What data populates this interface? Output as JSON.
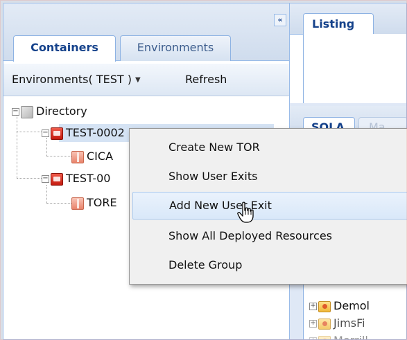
{
  "left_panel": {
    "collapse_icon": "double-chevron-left-icon",
    "tabs": [
      {
        "label": "Containers",
        "active": true
      },
      {
        "label": "Environments",
        "active": false
      }
    ],
    "toolbar": {
      "env_menu_label": "Environments( TEST )",
      "env_menu_caret": "▼",
      "refresh_label": "Refresh"
    },
    "tree": {
      "root": {
        "label": "Directory",
        "icon": "directory-icon",
        "expanded": true
      },
      "items": [
        {
          "label": "TEST-0002",
          "icon": "server-group-icon",
          "expanded": true,
          "selected": true
        },
        {
          "label": "CICA",
          "icon": "package-icon"
        },
        {
          "label": "TEST-00",
          "icon": "server-group-icon",
          "expanded": true
        },
        {
          "label": "TORE",
          "icon": "package-icon"
        }
      ]
    }
  },
  "right_panel": {
    "top_tab": "Listing",
    "inner_tabs": [
      {
        "label": "SOLA",
        "active": true
      },
      {
        "label": "Ma",
        "active": false
      }
    ],
    "tree_items": [
      {
        "label": "Demol",
        "icon": "folder-icon"
      },
      {
        "label": "JimsFi",
        "icon": "folder-icon"
      },
      {
        "label": "Merrill",
        "icon": "folder-icon"
      }
    ]
  },
  "context_menu": {
    "items": [
      {
        "label": "Create New TOR"
      },
      {
        "label": "Show User Exits"
      },
      {
        "label": "Add New User Exit",
        "hover": true
      },
      {
        "label": "Show All Deployed Resources"
      },
      {
        "label": "Delete Group"
      }
    ]
  },
  "colors": {
    "panel_header": "#dfe8f6",
    "border": "#99bbe8",
    "tab_text": "#15428b",
    "menu_hover": "#d9e8f9",
    "selected_row": "#d5e3f4"
  }
}
